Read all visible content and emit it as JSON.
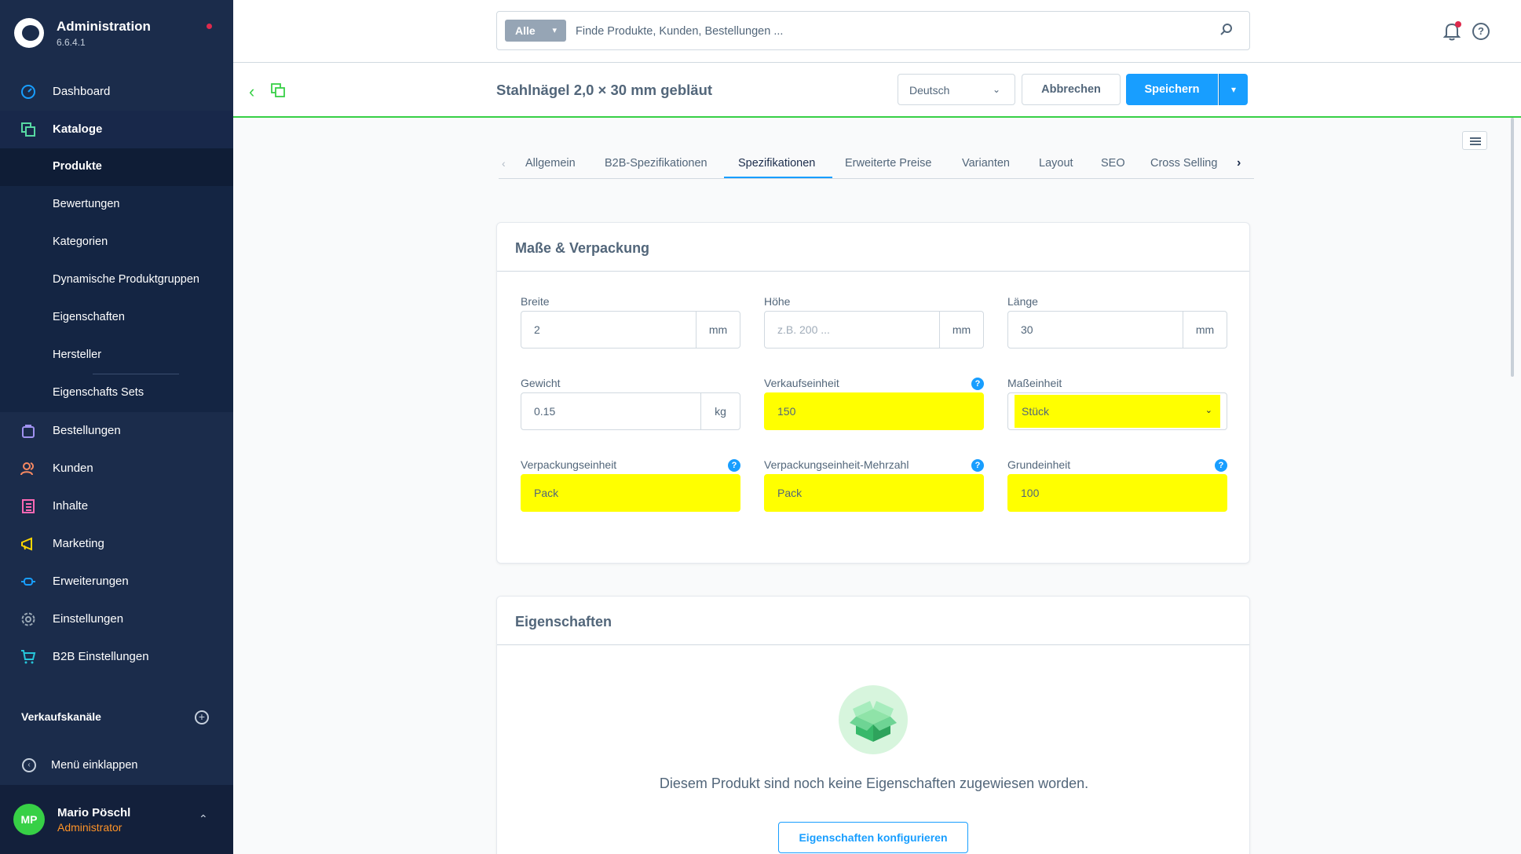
{
  "app": {
    "title": "Administration",
    "version": "6.6.4.1"
  },
  "sidebar": {
    "items": [
      {
        "label": "Dashboard",
        "icon": "dashboard-icon",
        "color": "#189eff"
      },
      {
        "label": "Kataloge",
        "icon": "catalog-icon",
        "color": "#57d9a3"
      },
      {
        "label": "Bestellungen",
        "icon": "orders-icon",
        "color": "#a092f0"
      },
      {
        "label": "Kunden",
        "icon": "customers-icon",
        "color": "#f88962"
      },
      {
        "label": "Inhalte",
        "icon": "content-icon",
        "color": "#ff68b4"
      },
      {
        "label": "Marketing",
        "icon": "marketing-icon",
        "color": "#ffd700"
      },
      {
        "label": "Erweiterungen",
        "icon": "plug-icon",
        "color": "#189eff"
      },
      {
        "label": "Einstellungen",
        "icon": "gear-icon",
        "color": "#9aa8b5"
      },
      {
        "label": "B2B Einstellungen",
        "icon": "b2b-cart-icon",
        "color": "#26c6da"
      }
    ],
    "sub_items": [
      "Produkte",
      "Bewertungen",
      "Kategorien",
      "Dynamische Produktgruppen",
      "Eigenschaften",
      "Hersteller",
      "Eigenschafts Sets"
    ],
    "sales_channels_label": "Verkaufskanäle",
    "collapse_label": "Menü einklappen",
    "user": {
      "initials": "MP",
      "name": "Mario Pöschl",
      "role": "Administrator"
    }
  },
  "search": {
    "type_label": "Alle",
    "placeholder": "Finde Produkte, Kunden, Bestellungen ..."
  },
  "smartbar": {
    "title": "Stahlnägel 2,0 × 30 mm gebläut",
    "language": "Deutsch",
    "cancel_label": "Abbrechen",
    "save_label": "Speichern"
  },
  "tabs": [
    "Allgemein",
    "B2B-Spezifikationen",
    "Spezifikationen",
    "Erweiterte Preise",
    "Varianten",
    "Layout",
    "SEO",
    "Cross Selling"
  ],
  "active_tab": "Spezifikationen",
  "dimensions_card": {
    "title": "Maße & Verpackung",
    "fields": {
      "width": {
        "label": "Breite",
        "value": "2",
        "unit": "mm"
      },
      "height": {
        "label": "Höhe",
        "value": "",
        "placeholder": "z.B. 200 ...",
        "unit": "mm"
      },
      "length": {
        "label": "Länge",
        "value": "30",
        "unit": "mm"
      },
      "weight": {
        "label": "Gewicht",
        "value": "0.15",
        "unit": "kg"
      },
      "purchase_unit": {
        "label": "Verkaufseinheit",
        "value": "150"
      },
      "unit": {
        "label": "Maßeinheit",
        "value": "Stück"
      },
      "pack_unit": {
        "label": "Verpackungseinheit",
        "value": "Pack"
      },
      "pack_unit_plural": {
        "label": "Verpackungseinheit-Mehrzahl",
        "value": "Pack"
      },
      "reference_unit": {
        "label": "Grundeinheit",
        "value": "100"
      }
    },
    "help_glyph": "?"
  },
  "properties_card": {
    "title": "Eigenschaften",
    "empty_text": "Diesem Produkt sind noch keine Eigenschaften zugewiesen worden.",
    "configure_label": "Eigenschaften konfigurieren"
  },
  "colors": {
    "sidebar_bg": "#1b2c4b",
    "primary": "#189eff",
    "highlight": "#ffff00",
    "success": "#37d046"
  }
}
